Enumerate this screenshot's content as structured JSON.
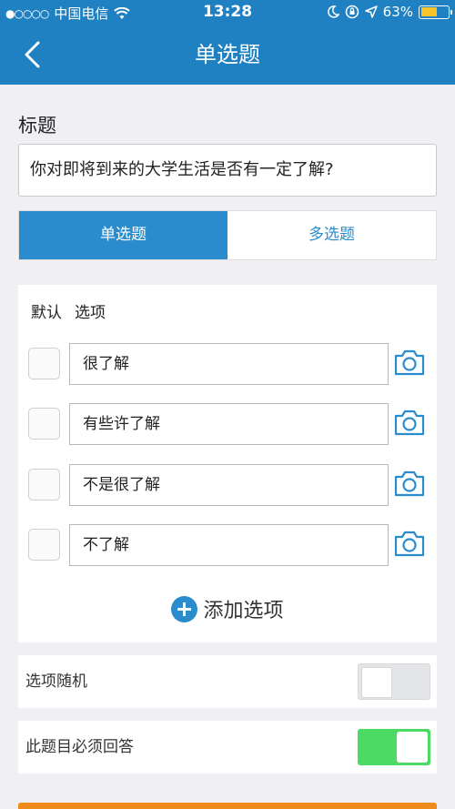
{
  "status_bar": {
    "signal": "●○○○○",
    "carrier": "中国电信",
    "wifi": "wifi-icon",
    "time": "13:28",
    "battery_text": "63%",
    "battery_level": 0.63,
    "icons": [
      "moon-icon",
      "orientation-lock-icon",
      "location-arrow-icon"
    ]
  },
  "nav": {
    "title": "单选题",
    "back_icon": "chevron-left-icon"
  },
  "title_section": {
    "label": "标题",
    "value": "你对即将到来的大学生活是否有一定了解?"
  },
  "question_type": {
    "tabs": [
      {
        "label": "单选题",
        "selected": true
      },
      {
        "label": "多选题",
        "selected": false
      }
    ]
  },
  "options": {
    "header_default": "默认",
    "header_option": "选项",
    "items": [
      {
        "value": "很了解",
        "checked": false
      },
      {
        "value": "有些许了解",
        "checked": false
      },
      {
        "value": "不是很了解",
        "checked": false
      },
      {
        "value": "不了解",
        "checked": false
      }
    ],
    "add_label": "添加选项"
  },
  "settings": {
    "random": {
      "label": "选项随机",
      "on": false
    },
    "required": {
      "label": "此题目必须回答",
      "on": true
    }
  },
  "colors": {
    "primary": "#1f81c1",
    "accent": "#2b8ccd",
    "toggle_on": "#4cd964",
    "bottom_button": "#f18a1c"
  }
}
